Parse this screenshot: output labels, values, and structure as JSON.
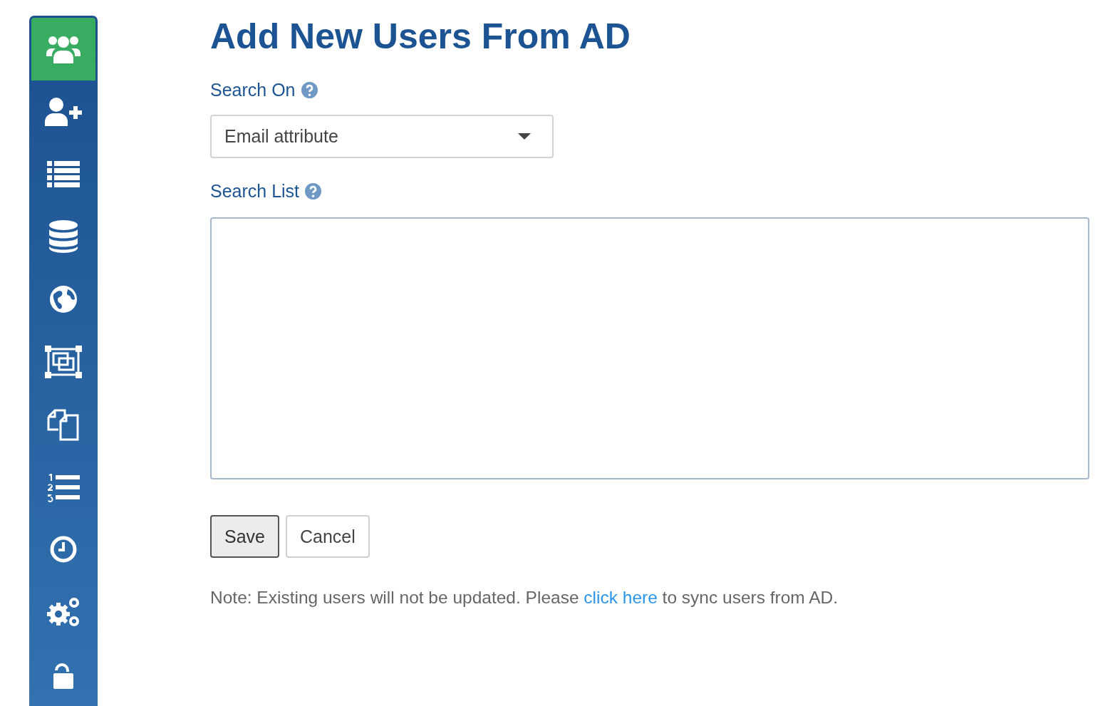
{
  "sidebar": {
    "items": [
      {
        "selected": true
      },
      {
        "selected": false
      },
      {
        "selected": false
      },
      {
        "selected": false
      },
      {
        "selected": false
      },
      {
        "selected": false
      },
      {
        "selected": false
      },
      {
        "selected": false
      },
      {
        "selected": false
      },
      {
        "selected": false
      },
      {
        "selected": false
      }
    ]
  },
  "title": "Add New Users From AD",
  "search_on": {
    "label": "Search On",
    "value": "Email attribute"
  },
  "search_list": {
    "label": "Search List"
  },
  "buttons": [
    {
      "label": "Save",
      "kind": "primary"
    },
    {
      "label": "Cancel",
      "kind": "secondary"
    }
  ],
  "note": {
    "before": "Note: Existing users will not be updated. Please ",
    "link": "click here",
    "after": " to sync users from AD."
  }
}
